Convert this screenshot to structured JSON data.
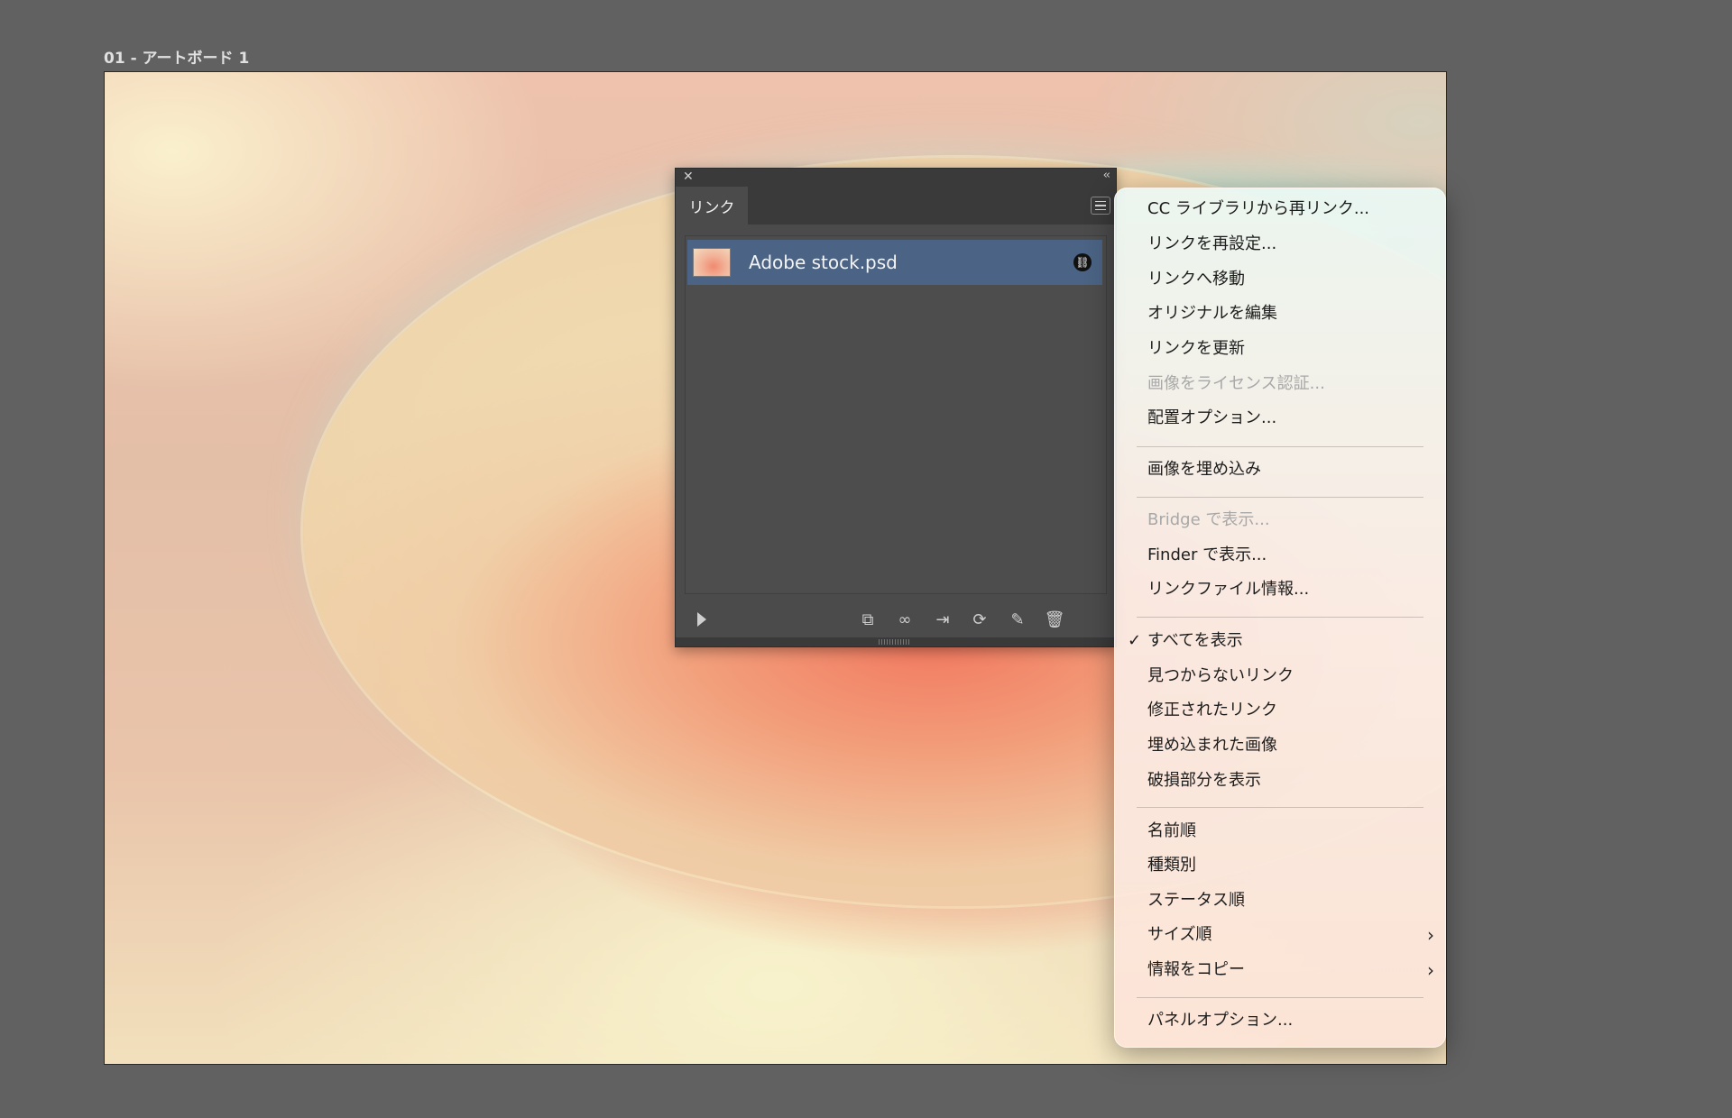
{
  "artboard": {
    "label": "01 - アートボード 1"
  },
  "panel": {
    "close_glyph": "✕",
    "collapse_glyph": "‹‹",
    "tab_label": "リンク",
    "link": {
      "name": "Adobe stock.psd"
    }
  },
  "menu": {
    "group1": [
      {
        "label": "CC ライブラリから再リンク...",
        "disabled": false
      },
      {
        "label": "リンクを再設定...",
        "disabled": false
      },
      {
        "label": "リンクへ移動",
        "disabled": false
      },
      {
        "label": "オリジナルを編集",
        "disabled": false
      },
      {
        "label": "リンクを更新",
        "disabled": false
      },
      {
        "label": "画像をライセンス認証...",
        "disabled": true
      },
      {
        "label": "配置オプション...",
        "disabled": false
      }
    ],
    "group2": [
      {
        "label": "画像を埋め込み",
        "disabled": false
      }
    ],
    "group3": [
      {
        "label": "Bridge で表示...",
        "disabled": true
      },
      {
        "label": "Finder で表示...",
        "disabled": false
      },
      {
        "label": "リンクファイル情報...",
        "disabled": false
      }
    ],
    "group4": [
      {
        "label": "すべてを表示",
        "checked": true
      },
      {
        "label": "見つからないリンク"
      },
      {
        "label": "修正されたリンク"
      },
      {
        "label": "埋め込まれた画像"
      },
      {
        "label": "破損部分を表示"
      }
    ],
    "group5": [
      {
        "label": "名前順"
      },
      {
        "label": "種類別"
      },
      {
        "label": "ステータス順"
      },
      {
        "label": "サイズ順",
        "submenu": true
      },
      {
        "label": "情報をコピー",
        "submenu": true
      }
    ],
    "group6": [
      {
        "label": "パネルオプション..."
      }
    ],
    "check_glyph": "✓",
    "submenu_glyph": "›"
  }
}
